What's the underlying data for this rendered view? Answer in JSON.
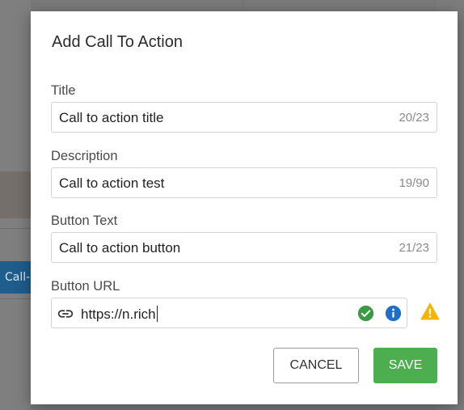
{
  "background": {
    "chip_label": "Call-"
  },
  "dialog": {
    "title": "Add Call To Action",
    "fields": [
      {
        "label": "Title",
        "value": "Call to action title",
        "counter": "20/23"
      },
      {
        "label": "Description",
        "value": "Call to action test",
        "counter": "19/90"
      },
      {
        "label": "Button Text",
        "value": "Call to action button",
        "counter": "21/23"
      }
    ],
    "url": {
      "label": "Button URL",
      "value": "https://n.rich",
      "icons": [
        "link-icon",
        "check-circle-icon",
        "info-icon",
        "warning-icon"
      ]
    },
    "buttons": {
      "cancel": "CANCEL",
      "save": "SAVE"
    }
  },
  "colors": {
    "accent_green": "#4cae4f",
    "info_blue": "#1f6fc9",
    "valid_green": "#3a9a44",
    "warning_yellow": "#f4b400",
    "chip_blue": "#1e5d8c"
  }
}
